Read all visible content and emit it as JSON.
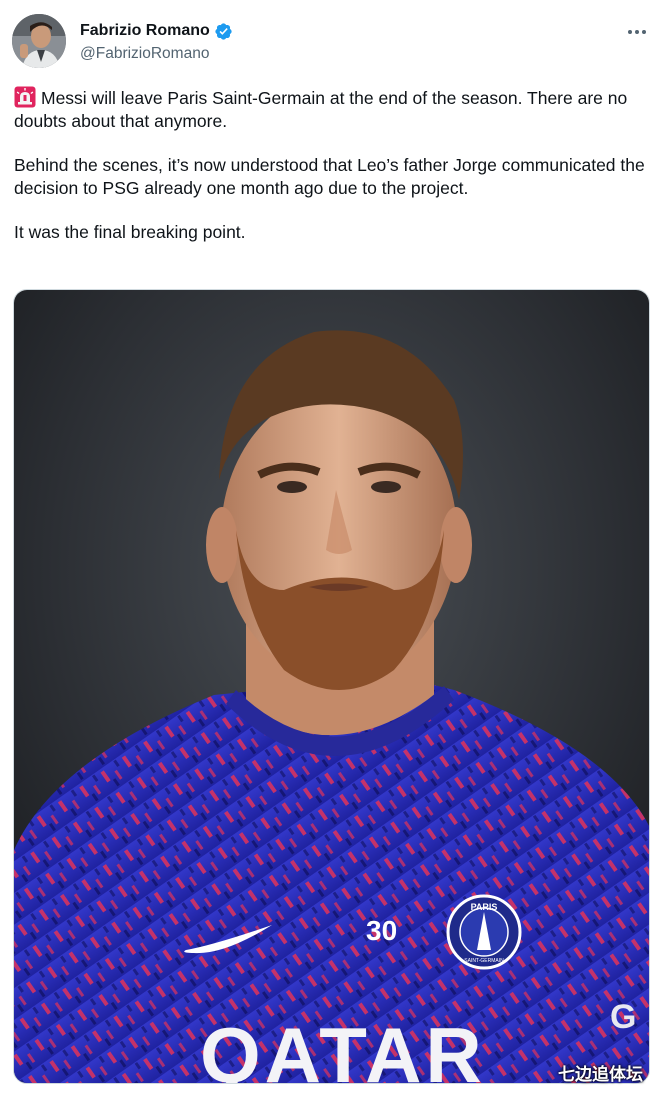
{
  "tweet": {
    "author": {
      "display_name": "Fabrizio Romano",
      "handle": "@FabrizioRomano",
      "verified": true,
      "avatar_icon": "profile-photo"
    },
    "menu_icon": "more-horizontal-icon",
    "text": {
      "emoji": "siren-icon",
      "paragraph_1": "Messi will leave Paris Saint-Germain at the end of the season. There are no doubts about that anymore.",
      "paragraph_2": "Behind the scenes, it’s now understood that Leo’s father Jorge communicated the decision to PSG already one month ago due to the project.",
      "paragraph_3": "It was the final breaking point."
    },
    "media": {
      "shirt_number": "30",
      "sponsor": "QATAR",
      "crest_text_top": "PARIS",
      "crest_text_bottom": "SAINT-GERMAIN",
      "sleeve_letters": "G",
      "watermark": "七边追体坛"
    }
  },
  "colors": {
    "text_primary": "#0f1419",
    "text_secondary": "#536471",
    "verified_blue": "#1d9bf0",
    "jersey_blue": "#2b2fbf",
    "jersey_red": "#e0325a"
  }
}
